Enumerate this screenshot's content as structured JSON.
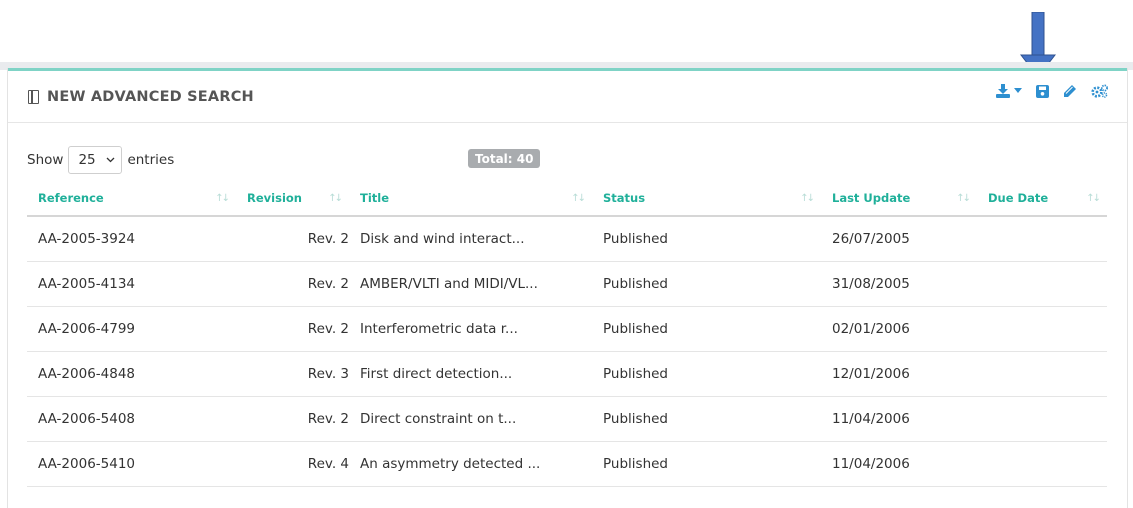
{
  "panel": {
    "title": "NEW ADVANCED SEARCH",
    "accent_color": "#7fd3c6",
    "link_color": "#2d8fd0",
    "header_color": "#20b09a",
    "annotation_arrow_color": "#4472c4"
  },
  "toolbar": {
    "icons": [
      "download-icon",
      "save-icon",
      "edit-icon",
      "settings-icon"
    ]
  },
  "controls": {
    "show_label": "Show",
    "entries_value": "25",
    "entries_label": "entries",
    "total_label": "Total: 40"
  },
  "table": {
    "columns": [
      "Reference",
      "Revision",
      "Title",
      "Status",
      "Last Update",
      "Due Date"
    ],
    "rows": [
      {
        "reference": "AA-2005-3924",
        "revision": "Rev. 2",
        "title": "Disk and wind interact...",
        "status": "Published",
        "last_update": "26/07/2005",
        "due_date": ""
      },
      {
        "reference": "AA-2005-4134",
        "revision": "Rev. 2",
        "title": "AMBER/VLTI and MIDI/VL...",
        "status": "Published",
        "last_update": "31/08/2005",
        "due_date": ""
      },
      {
        "reference": "AA-2006-4799",
        "revision": "Rev. 2",
        "title": "Interferometric data r...",
        "status": "Published",
        "last_update": "02/01/2006",
        "due_date": ""
      },
      {
        "reference": "AA-2006-4848",
        "revision": "Rev. 3",
        "title": "First direct detection...",
        "status": "Published",
        "last_update": "12/01/2006",
        "due_date": ""
      },
      {
        "reference": "AA-2006-5408",
        "revision": "Rev. 2",
        "title": "Direct constraint on t...",
        "status": "Published",
        "last_update": "11/04/2006",
        "due_date": ""
      },
      {
        "reference": "AA-2006-5410",
        "revision": "Rev. 4",
        "title": "An asymmetry detected ...",
        "status": "Published",
        "last_update": "11/04/2006",
        "due_date": ""
      }
    ]
  }
}
